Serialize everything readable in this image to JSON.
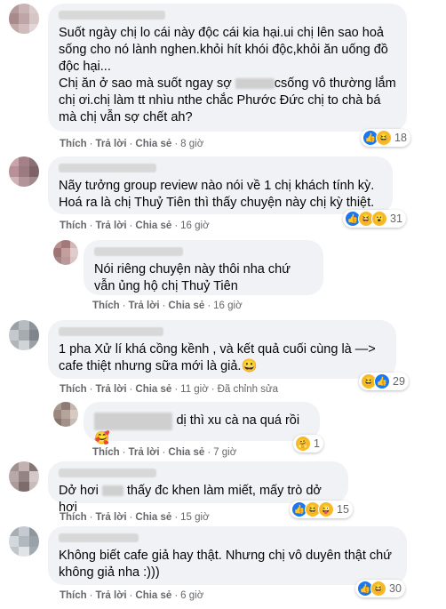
{
  "comments": [
    {
      "text": "Suốt ngày chị lo cái này độc cái kia hại.ui chị lên sao hoả sống cho nó lành nghen.khỏi hít khói độc,khỏi ăn uống đồ độc hại...",
      "text2a": "Chị ăn ở sao mà suốt ngay sợ",
      "text2b": "csống vô thường lắm chị ơi.chị làm tt nhìu nthe chắc Phước Đức chị to chà bá mà chị vẫn sợ chết ah?",
      "like": "Thích",
      "reply": "Trả lời",
      "share": "Chia sẻ",
      "time": "8 giờ",
      "reaction_count": "18"
    },
    {
      "text": "Nãy tưởng group review nào nói về 1 chị khách tính kỳ. Hoá ra là chị Thuỷ Tiên thì thấy chuyện này chị kỳ thiệt.",
      "like": "Thích",
      "reply": "Trả lời",
      "share": "Chia sẻ",
      "time": "16 giờ",
      "reaction_count": "31"
    },
    {
      "text": "Nói riêng chuyện này thôi nha chứ vẫn ủng hộ chị Thuỷ Tiên",
      "like": "Thích",
      "reply": "Trả lời",
      "share": "Chia sẻ",
      "time": "16 giờ"
    },
    {
      "text": "1 pha Xử lí khá cồng kềnh , và kết quả cuối cùng là —> cafe thiệt nhưng sữa mới là giả.😀",
      "like": "Thích",
      "reply": "Trả lời",
      "share": "Chia sẻ",
      "time": "11 giờ",
      "edited": "Đã chỉnh sửa",
      "reaction_count": "29"
    },
    {
      "text": "dị thì xu cà na quá rồi",
      "like": "Thích",
      "reply": "Trả lời",
      "share": "Chia sẻ",
      "time": "7 giờ",
      "reaction_count": "1"
    },
    {
      "text_a": "Dở hơi",
      "text_b": "thấy đc khen làm miết, mấy trò dở hơi",
      "like": "Thích",
      "reply": "Trả lời",
      "share": "Chia sẻ",
      "time": "15 giờ",
      "reaction_count": "15"
    },
    {
      "text": "Không biết cafe giả hay thật. Nhưng chị vô duyên thật chứ không giả nha :)))",
      "like": "Thích",
      "reply": "Trả lời",
      "share": "Chia sẻ",
      "time": "6 giờ",
      "reaction_count": "30"
    }
  ],
  "icons": {
    "like": "like-icon",
    "haha": "haha-icon",
    "wow": "wow-icon",
    "care": "care-icon"
  },
  "colors": {
    "bubble": "#f0f2f5",
    "meta": "#65676b",
    "like": "#1877f2",
    "emoji": "#f7b928"
  }
}
